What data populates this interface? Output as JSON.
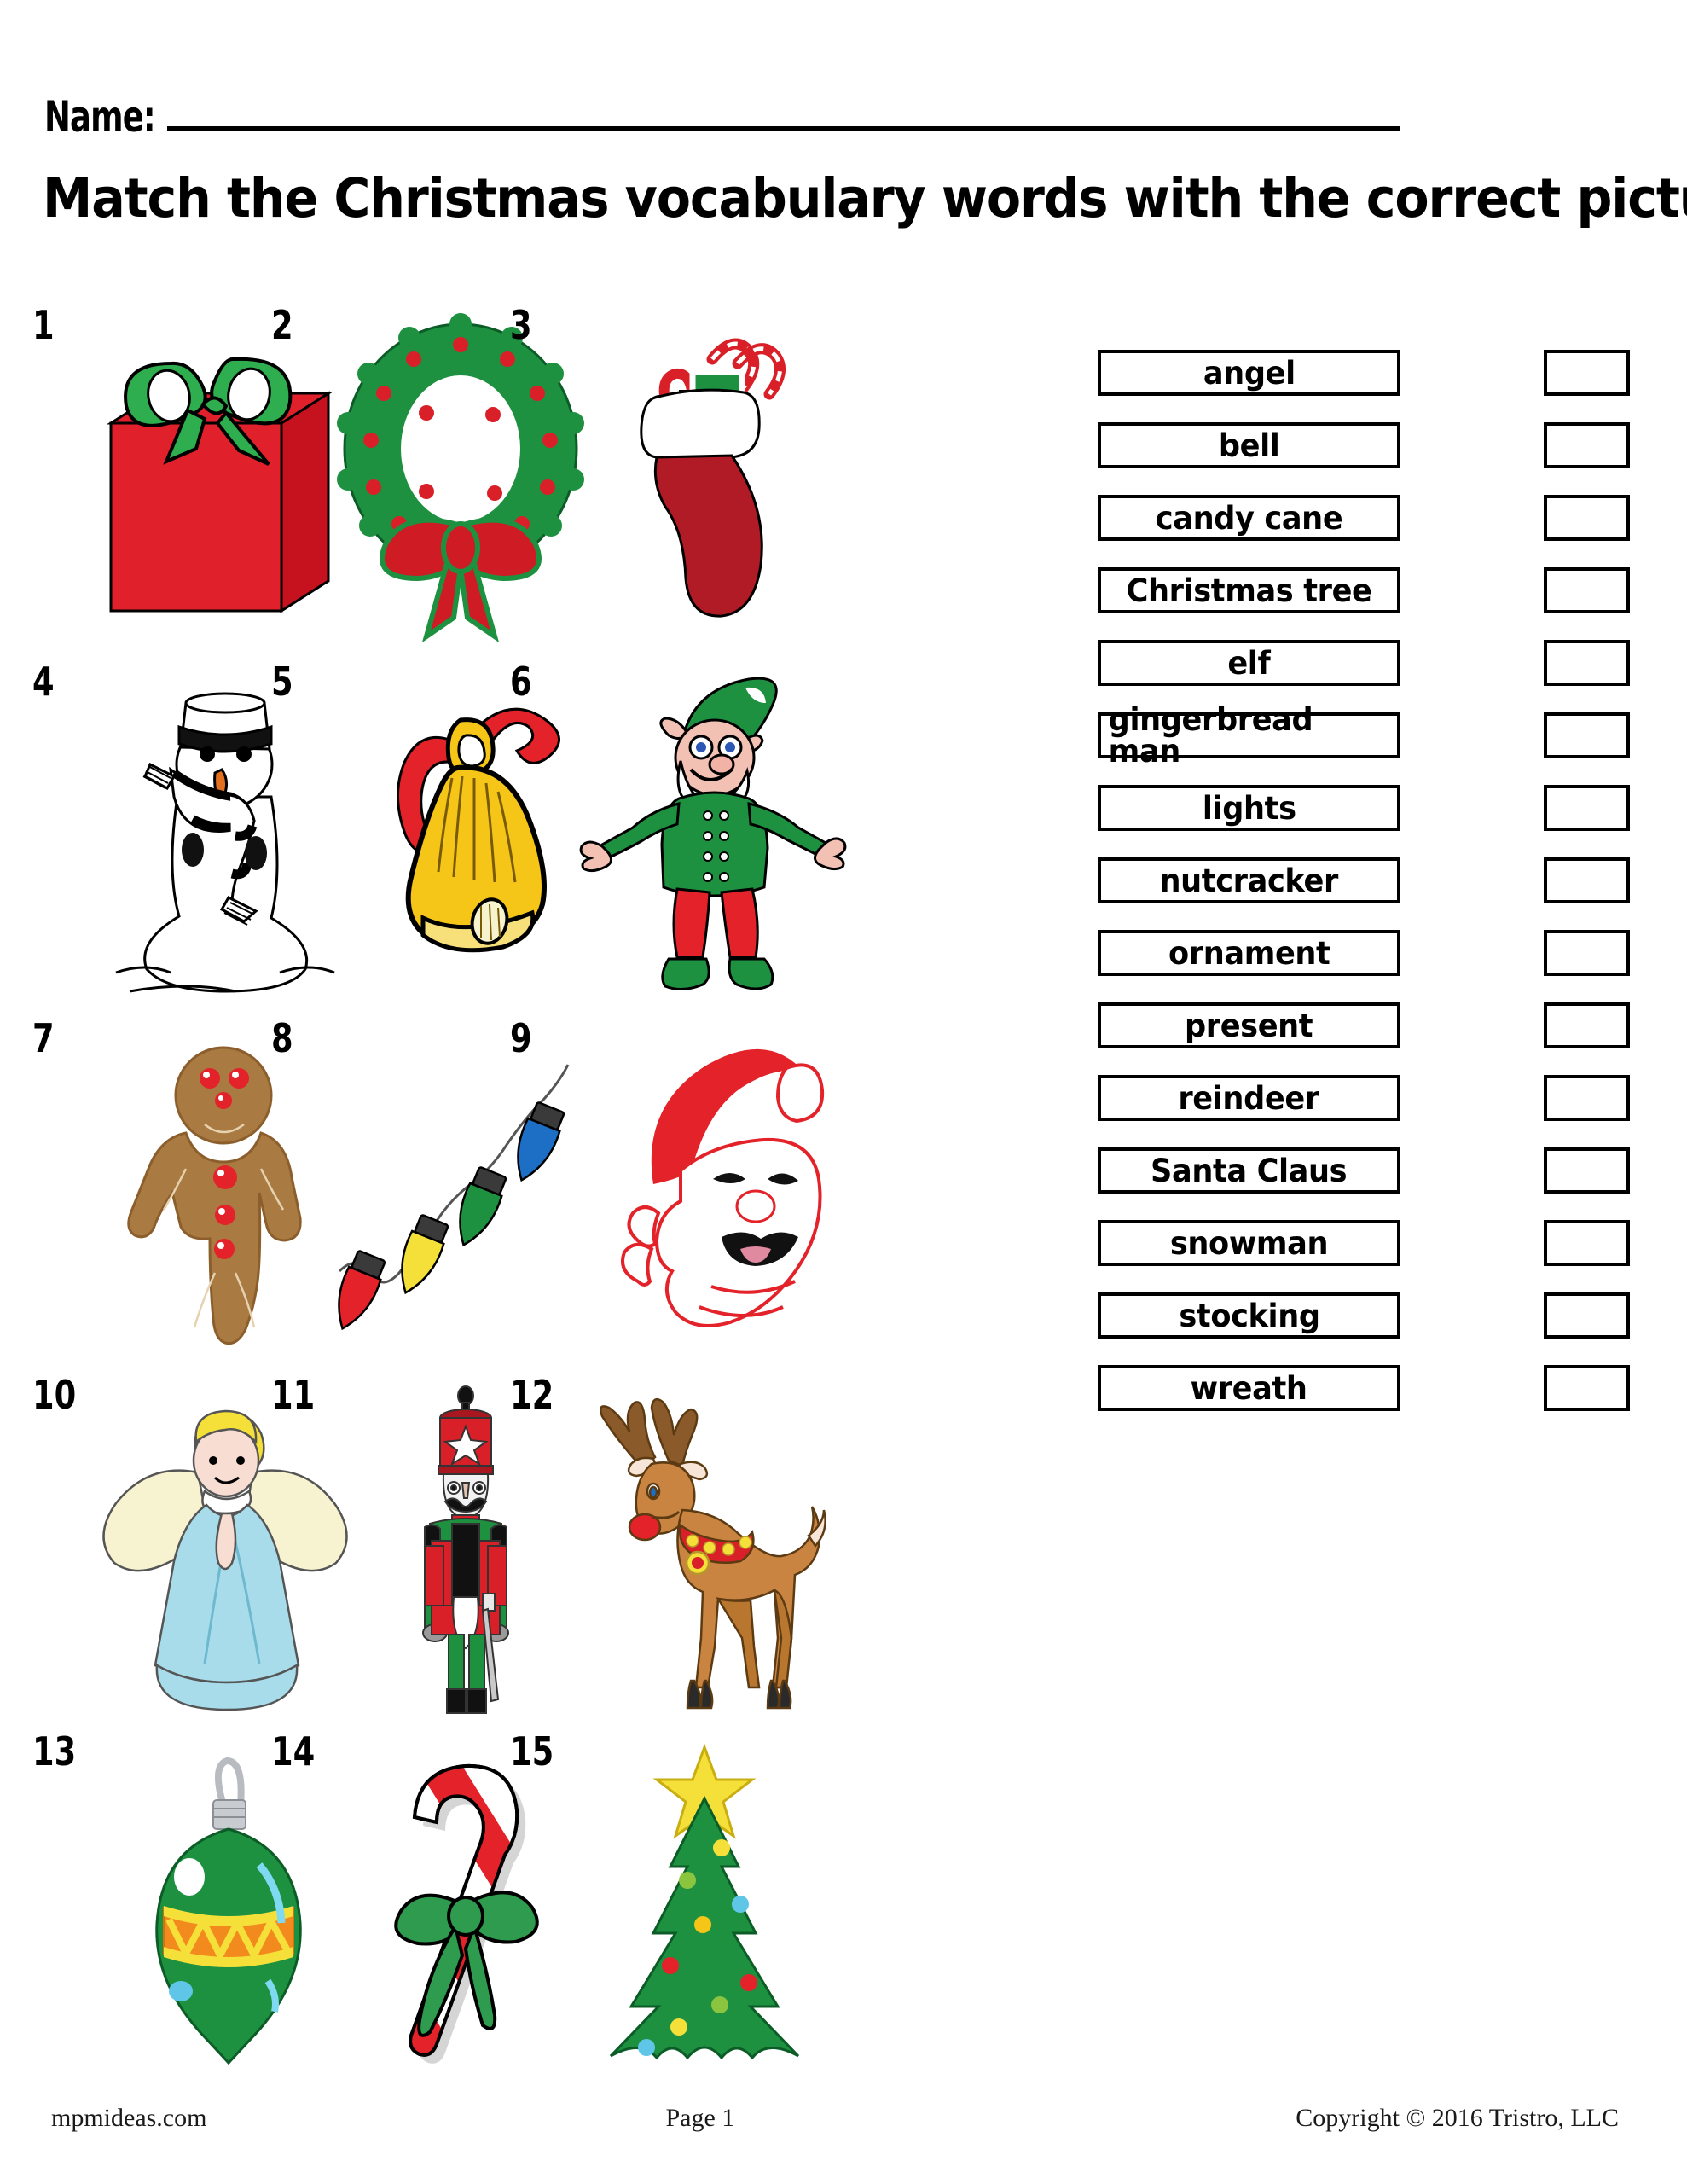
{
  "header": {
    "name_label": "Name:",
    "title": "Match the Christmas vocabulary words with the correct picture."
  },
  "pictures": [
    {
      "number": "1",
      "icon": "present-icon",
      "label": "present"
    },
    {
      "number": "2",
      "icon": "wreath-icon",
      "label": "wreath"
    },
    {
      "number": "3",
      "icon": "stocking-icon",
      "label": "stocking"
    },
    {
      "number": "4",
      "icon": "snowman-icon",
      "label": "snowman"
    },
    {
      "number": "5",
      "icon": "bell-icon",
      "label": "bell"
    },
    {
      "number": "6",
      "icon": "elf-icon",
      "label": "elf"
    },
    {
      "number": "7",
      "icon": "gingerbread-man-icon",
      "label": "gingerbread man"
    },
    {
      "number": "8",
      "icon": "lights-icon",
      "label": "lights"
    },
    {
      "number": "9",
      "icon": "santa-claus-icon",
      "label": "Santa Claus"
    },
    {
      "number": "10",
      "icon": "angel-icon",
      "label": "angel"
    },
    {
      "number": "11",
      "icon": "nutcracker-icon",
      "label": "nutcracker"
    },
    {
      "number": "12",
      "icon": "reindeer-icon",
      "label": "reindeer"
    },
    {
      "number": "13",
      "icon": "ornament-icon",
      "label": "ornament"
    },
    {
      "number": "14",
      "icon": "candy-cane-icon",
      "label": "candy cane"
    },
    {
      "number": "15",
      "icon": "christmas-tree-icon",
      "label": "Christmas tree"
    }
  ],
  "word_list": [
    {
      "word": "angel",
      "answer": ""
    },
    {
      "word": "bell",
      "answer": ""
    },
    {
      "word": "candy cane",
      "answer": ""
    },
    {
      "word": "Christmas tree",
      "answer": ""
    },
    {
      "word": "elf",
      "answer": ""
    },
    {
      "word": "gingerbread man",
      "answer": ""
    },
    {
      "word": "lights",
      "answer": ""
    },
    {
      "word": "nutcracker",
      "answer": ""
    },
    {
      "word": "ornament",
      "answer": ""
    },
    {
      "word": "present",
      "answer": ""
    },
    {
      "word": "reindeer",
      "answer": ""
    },
    {
      "word": "Santa Claus",
      "answer": ""
    },
    {
      "word": "snowman",
      "answer": ""
    },
    {
      "word": "stocking",
      "answer": ""
    },
    {
      "word": "wreath",
      "answer": ""
    }
  ],
  "footer": {
    "site": "mpmideas.com",
    "page": "Page 1",
    "copyright": "Copyright © 2016 Tristro, LLC"
  },
  "colors": {
    "red": "#E0212C",
    "green": "#1E9141",
    "dark_green": "#0F7B36",
    "gold": "#F5C518",
    "brown": "#B5803C",
    "gingerbread": "#A97A42",
    "blue": "#1C6FC4",
    "light_blue": "#A8DCEA",
    "yellow": "#F5E03A",
    "cream": "#F7F3D0",
    "skin": "#F7D3C4",
    "black": "#000000",
    "white": "#FFFFFF"
  }
}
